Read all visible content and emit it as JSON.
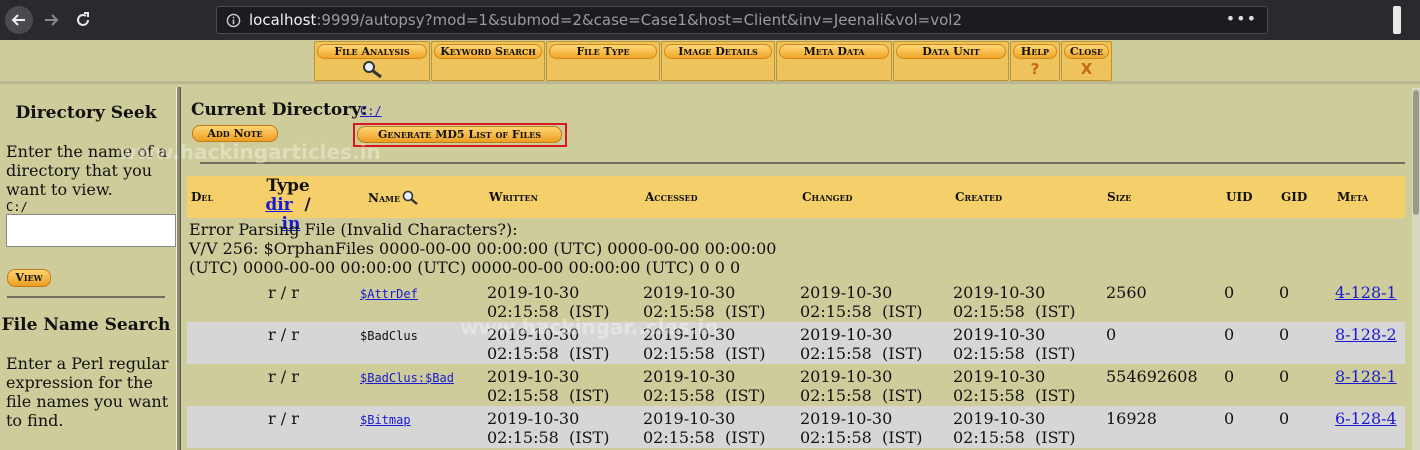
{
  "browser": {
    "url_prefix": "",
    "url_host": "localhost",
    "url_rest": ":9999/autopsy?mod=1&submod=2&case=Case1&host=Client&inv=Jeenali&vol=vol2",
    "url_menu": "•••"
  },
  "tabs": [
    {
      "label": "File Analysis",
      "glyph": "🔍"
    },
    {
      "label": "Keyword Search",
      "glyph": ""
    },
    {
      "label": "File Type",
      "glyph": ""
    },
    {
      "label": "Image Details",
      "glyph": ""
    },
    {
      "label": "Meta Data",
      "glyph": ""
    },
    {
      "label": "Data Unit",
      "glyph": ""
    },
    {
      "label": "Help",
      "glyph": "?"
    },
    {
      "label": "Close",
      "glyph": "X"
    }
  ],
  "sidebar": {
    "dir_seek_title": "Directory Seek",
    "dir_seek_text": "Enter the name of a directory that you want to view.",
    "dir_seek_path": "C:/",
    "dir_seek_value": "",
    "view_button": "View",
    "file_search_title": "File Name Search",
    "file_search_text": "Enter a Perl regular expression for the file names you want to find."
  },
  "main": {
    "current_dir_label": "Current Directory:",
    "current_dir_link": "C:/",
    "add_note_button": "Add Note",
    "md5_button": "Generate MD5 List of Files"
  },
  "table": {
    "headers": {
      "del": "Del",
      "type_title": "Type",
      "type_dir": "dir",
      "type_sep": "/",
      "type_in": "in",
      "name": "Name",
      "written": "Written",
      "accessed": "Accessed",
      "changed": "Changed",
      "created": "Created",
      "size": "Size",
      "uid": "UID",
      "gid": "GID",
      "meta": "Meta"
    },
    "error_lines": [
      "Error Parsing File (Invalid Characters?):",
      "V/V 256: $OrphanFiles 0000-00-00 00:00:00 (UTC) 0000-00-00 00:00:00",
      "(UTC) 0000-00-00 00:00:00 (UTC) 0000-00-00 00:00:00 (UTC) 0 0 0"
    ],
    "rows": [
      {
        "type": "r / r",
        "name": "$AttrDef",
        "link": true,
        "date": "2019-10-30",
        "time": "02:15:58  (IST)",
        "size": "2560",
        "uid": "0",
        "gid": "0",
        "meta": "4-128-1"
      },
      {
        "type": "r / r",
        "name": "$BadClus",
        "link": false,
        "date": "2019-10-30",
        "time": "02:15:58  (IST)",
        "size": "0",
        "uid": "0",
        "gid": "0",
        "meta": "8-128-2"
      },
      {
        "type": "r / r",
        "name": "$BadClus:$Bad",
        "link": true,
        "date": "2019-10-30",
        "time": "02:15:58  (IST)",
        "size": "554692608",
        "uid": "0",
        "gid": "0",
        "meta": "8-128-1"
      },
      {
        "type": "r / r",
        "name": "$Bitmap",
        "link": true,
        "date": "2019-10-30",
        "time": "02:15:58  (IST)",
        "size": "16928",
        "uid": "0",
        "gid": "0",
        "meta": "6-128-4"
      }
    ]
  },
  "watermark": "www.hackingarticles.in",
  "watermark_partial": "www.hackingar..cles.in",
  "colors": {
    "background": "#cdcc9a",
    "header_row": "#f4cf6a",
    "alt_row": "#d6d6d6",
    "link": "#1a1ad4",
    "highlight": "#d8181c"
  }
}
